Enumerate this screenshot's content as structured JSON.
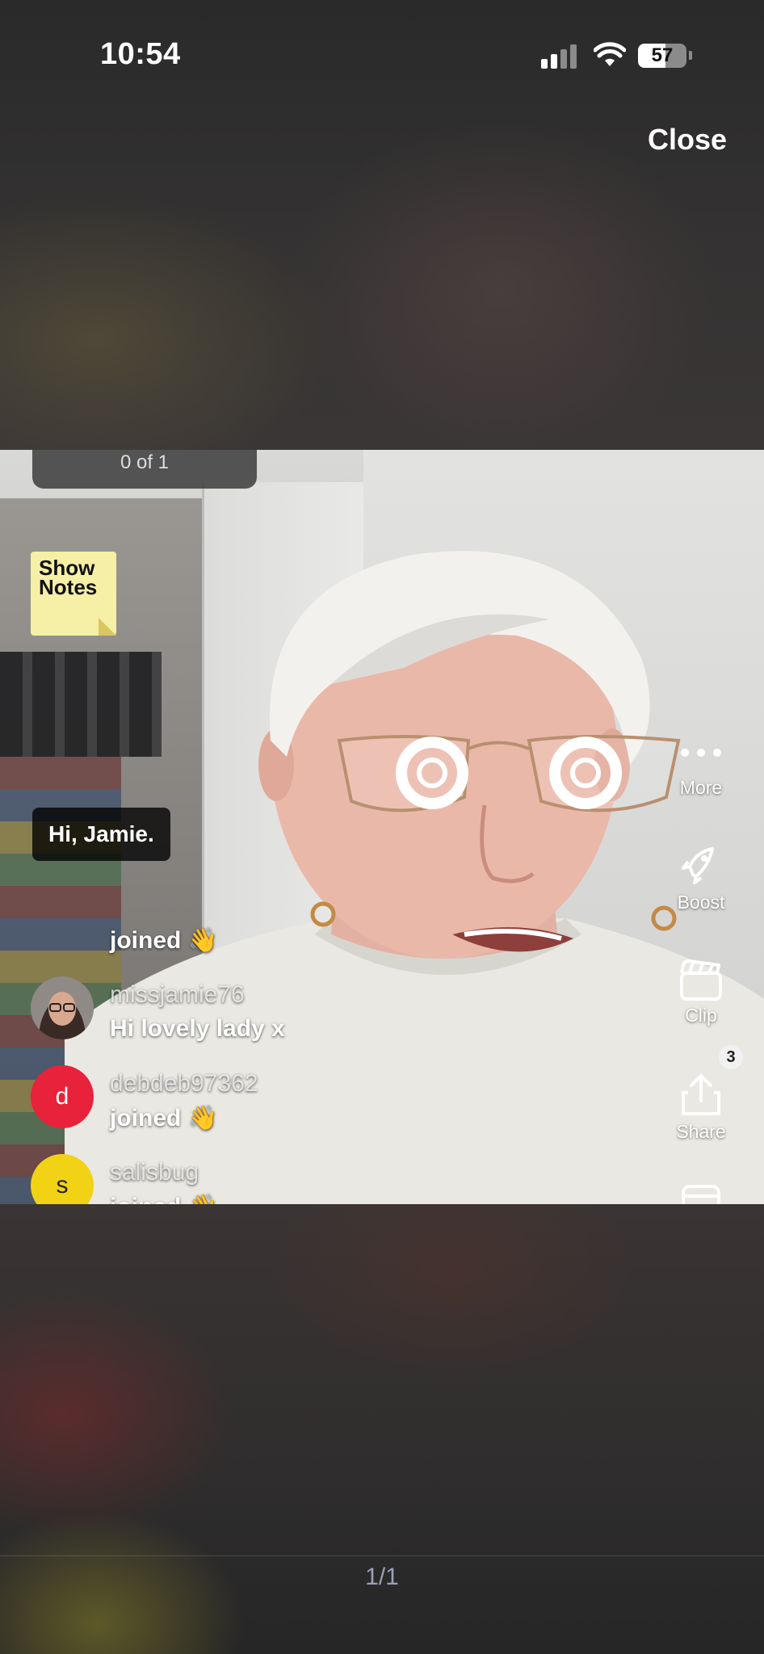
{
  "status_bar": {
    "time": "10:54",
    "battery": "57",
    "battery_level": 0.57
  },
  "header": {
    "close_label": "Close"
  },
  "video": {
    "counter": "0 of 1",
    "show_notes_label": "Show\nNotes",
    "greeting": "Hi, Jamie."
  },
  "chat": {
    "items": [
      {
        "user": "",
        "message": "joined 👋",
        "avatar_letter": "",
        "avatar_color": ""
      },
      {
        "user": "missjamie76",
        "message": "Hi lovely lady x",
        "avatar_letter": "",
        "avatar_color": "#7a6a6a"
      },
      {
        "user": "debdeb97362",
        "message": "joined 👋",
        "avatar_letter": "d",
        "avatar_color": "#e8223a"
      },
      {
        "user": "salisbug",
        "message": "joined 👋",
        "avatar_letter": "s",
        "avatar_color": "#f2d214"
      }
    ]
  },
  "actions": {
    "more": "More",
    "boost": "Boost",
    "clip": "Clip",
    "share": "Share",
    "share_badge": "3"
  },
  "pager": "1/1",
  "colors": {
    "background": "#2c2b2b",
    "pager_text": "#9aa0b8"
  }
}
